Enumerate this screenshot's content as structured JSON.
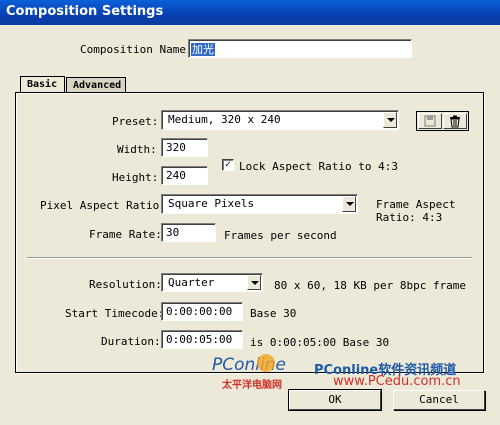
{
  "window": {
    "title": "Composition Settings"
  },
  "comp_name": {
    "label": "Composition Name:",
    "value": "加光"
  },
  "tabs": [
    {
      "label": "Basic"
    },
    {
      "label": "Advanced"
    }
  ],
  "preset": {
    "label": "Preset:",
    "value": "Medium, 320 x 240"
  },
  "width": {
    "label": "Width:",
    "value": "320"
  },
  "height": {
    "label": "Height:",
    "value": "240"
  },
  "lock_aspect": {
    "label": "Lock Aspect Ratio to 4:3",
    "checked": true,
    "mark": "✓"
  },
  "pixel_aspect": {
    "label": "Pixel Aspect Ratio:",
    "value": "Square Pixels",
    "frame_aspect_line1": "Frame Aspect",
    "frame_aspect_line2": "Ratio: 4:3"
  },
  "frame_rate": {
    "label": "Frame Rate:",
    "value": "30",
    "unit": "Frames per second"
  },
  "resolution": {
    "label": "Resolution:",
    "value": "Quarter",
    "info": "80 x 60, 18 KB per 8bpc frame"
  },
  "start_timecode": {
    "label": "Start Timecode:",
    "value": "0:00:00:00",
    "base": "Base 30"
  },
  "duration": {
    "label": "Duration:",
    "value": "0:00:05:00",
    "info": "is 0:00:05:00  Base 30"
  },
  "buttons": {
    "ok": "OK",
    "cancel": "Cancel"
  },
  "watermark": {
    "logo": "PConline",
    "logo_sub": "太平洋电脑网",
    "site_name": "PConline软件资讯频道",
    "url": "www.PCedu.com.cn"
  },
  "colors": {
    "title_bar": "#0a4fc8",
    "dialog_bg": "#ece9d8",
    "watermark_blue": "#1e5aa8",
    "watermark_red": "#d0302a"
  }
}
